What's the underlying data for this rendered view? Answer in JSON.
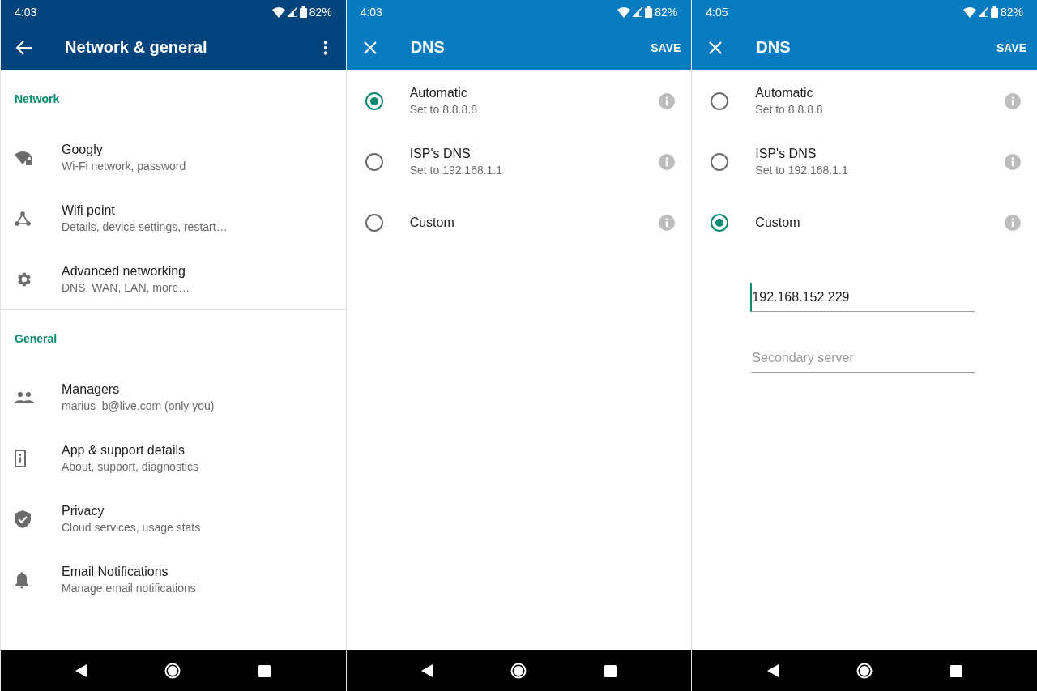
{
  "screens": [
    {
      "kind": "settings",
      "status": {
        "time": "4:03",
        "battery": "82%"
      },
      "title": "Network & general",
      "sections": [
        {
          "title": "Network",
          "items": [
            {
              "title": "Googly",
              "subtitle": "Wi-Fi network, password"
            },
            {
              "title": "Wifi point",
              "subtitle": "Details, device settings, restart…"
            },
            {
              "title": "Advanced networking",
              "subtitle": "DNS, WAN, LAN, more…"
            }
          ]
        },
        {
          "title": "General",
          "items": [
            {
              "title": "Managers",
              "subtitle": "marius_b@live.com (only you)"
            },
            {
              "title": "App & support details",
              "subtitle": "About, support, diagnostics"
            },
            {
              "title": "Privacy",
              "subtitle": "Cloud services, usage stats"
            },
            {
              "title": "Email Notifications",
              "subtitle": "Manage email notifications"
            }
          ]
        }
      ]
    },
    {
      "kind": "dns",
      "status": {
        "time": "4:03",
        "battery": "82%"
      },
      "title": "DNS",
      "action": "SAVE",
      "options": [
        {
          "title": "Automatic",
          "subtitle": "Set to 8.8.8.8",
          "selected": true
        },
        {
          "title": "ISP's DNS",
          "subtitle": "Set to 192.168.1.1",
          "selected": false
        },
        {
          "title": "Custom",
          "selected": false
        }
      ]
    },
    {
      "kind": "dns",
      "status": {
        "time": "4:05",
        "battery": "82%"
      },
      "title": "DNS",
      "action": "SAVE",
      "options": [
        {
          "title": "Automatic",
          "subtitle": "Set to 8.8.8.8",
          "selected": false
        },
        {
          "title": "ISP's DNS",
          "subtitle": "Set to 192.168.1.1",
          "selected": false
        },
        {
          "title": "Custom",
          "selected": true
        }
      ],
      "fields": [
        {
          "value": "192.168.152.229",
          "focused": true
        },
        {
          "placeholder": "Secondary server",
          "focused": false
        }
      ]
    }
  ]
}
